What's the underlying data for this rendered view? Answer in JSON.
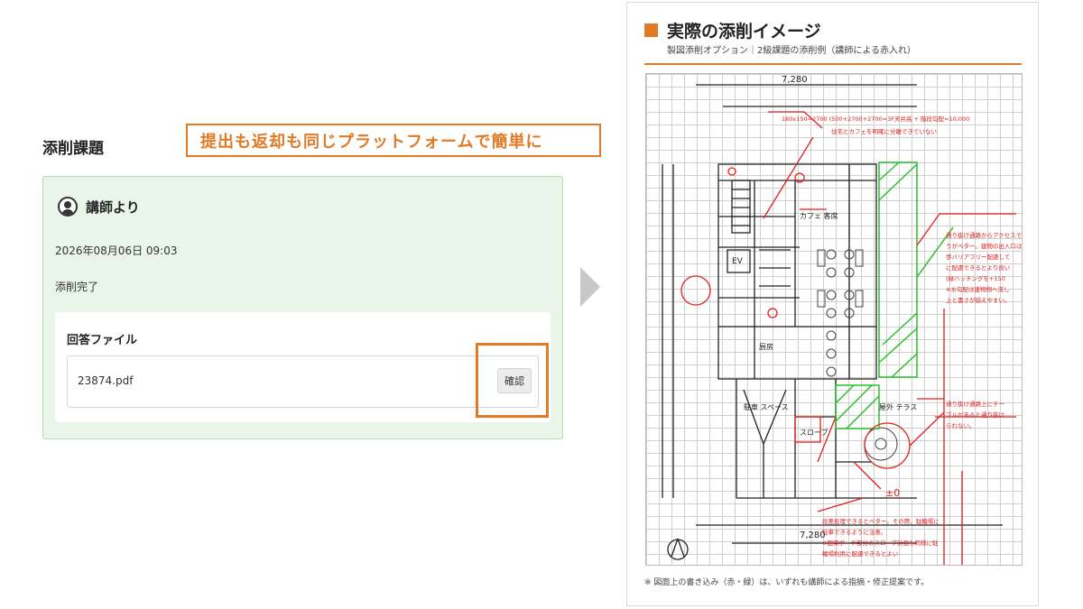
{
  "section": {
    "title": "添削課題"
  },
  "callout": {
    "text": "提出も返却も同じプラットフォームで簡単に"
  },
  "card": {
    "author": "講師より",
    "date": "2026年08月06日 09:03",
    "message": "添削完了",
    "answer_section": {
      "title": "回答ファイル",
      "file_name": "23874.pdf",
      "confirm_label": "確認"
    }
  },
  "document": {
    "title": "実際の添削イメージ",
    "subtitle": "製図添削オプション｜2級課題の添削例（講師による赤入れ）",
    "footnote": "※ 図面上の書き込み（赤・緑）は、いずれも講師による指摘・修正提案です。",
    "drawing_annotations": [
      "180x150=2700 (500+2700+2700=3F天井高 + 階段勾配=10,000",
      "住宅とカフェを明確に分離できていない",
      "通り抜け通路からアクセスできるように、カフェと書店を",
      "うがベター。建物の出入口は",
      "歩バリアフリー配慮して",
      "に配慮できるとより良い",
      "(緑ハッチングを+150",
      "※水勾配は建物側へ流し",
      "上と書さが揃えやすい。",
      "通り抜け通路上にテー",
      "ブルがあると通り抜け",
      "られない。",
      "段差処理できるとベター。その際、駐輪場に",
      "駐車できるように注意。",
      "※国東ポーチ部分のスロープ計画も同様に駐",
      "輪場利用に配慮できるとよい"
    ],
    "drawing_labels": {
      "dim_top": "7,280",
      "dim_bottom": "7,280",
      "cafe": "カフェ 客席",
      "parking": "駐車 スペース",
      "terrace": "屋外 テラス",
      "slope": "スロープ",
      "ev": "EV",
      "kitchen": "厨房",
      "zero": "±0"
    }
  },
  "colors": {
    "accent": "#e07a25",
    "card_bg": "#eaf5e9",
    "card_border": "#b9dcb5",
    "red_pen": "#e02020",
    "green_pen": "#2bbf2b"
  },
  "icons": {
    "avatar": "user-avatar-icon",
    "arrow": "arrow-right-icon",
    "north": "north-arrow-icon"
  }
}
